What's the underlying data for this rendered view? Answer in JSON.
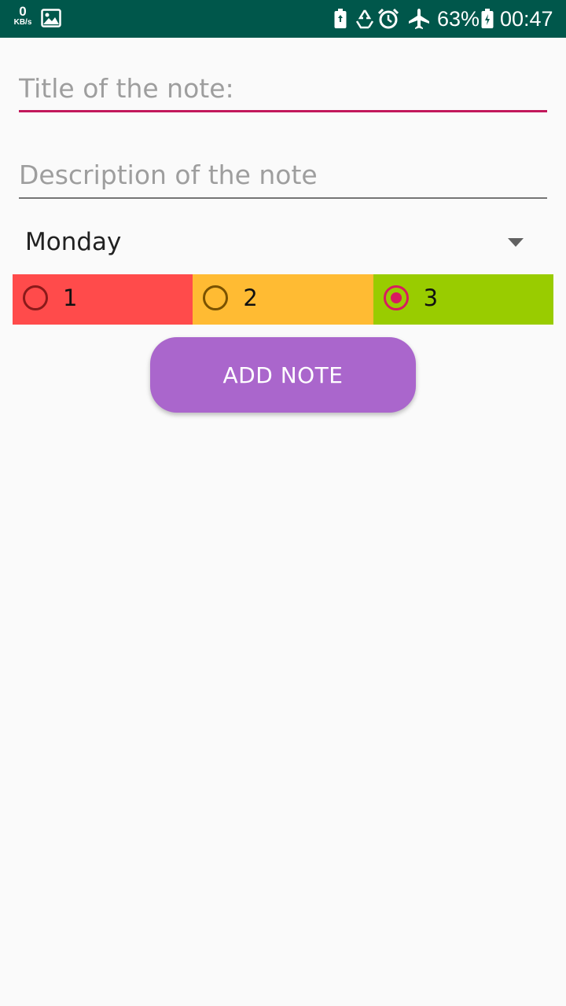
{
  "status_bar": {
    "net_speed_value": "0",
    "net_speed_unit": "KB/s",
    "battery_percent": "63%",
    "time": "00:47",
    "icons": [
      "gallery-icon",
      "battery-saver-icon",
      "recycle-icon",
      "alarm-icon",
      "airplane-mode-icon",
      "battery-icon"
    ]
  },
  "form": {
    "title_field": {
      "value": "",
      "placeholder": "Title of the note:"
    },
    "description_field": {
      "value": "",
      "placeholder": "Description of the note"
    },
    "day_spinner": {
      "selected": "Monday"
    },
    "priority": {
      "selected": "3",
      "options": [
        {
          "label": "1",
          "color": "#ff4b4b",
          "ring_color": "#8b1a1a"
        },
        {
          "label": "2",
          "color": "#ffbb33",
          "ring_color": "#7a5200"
        },
        {
          "label": "3",
          "color": "#99cc00",
          "ring_color": "#d81b60"
        }
      ]
    },
    "add_button_label": "ADD NOTE"
  },
  "colors": {
    "status_bar": "#00574b",
    "accent": "#c2185b",
    "button": "#aa66cc",
    "background": "#fafafa"
  }
}
